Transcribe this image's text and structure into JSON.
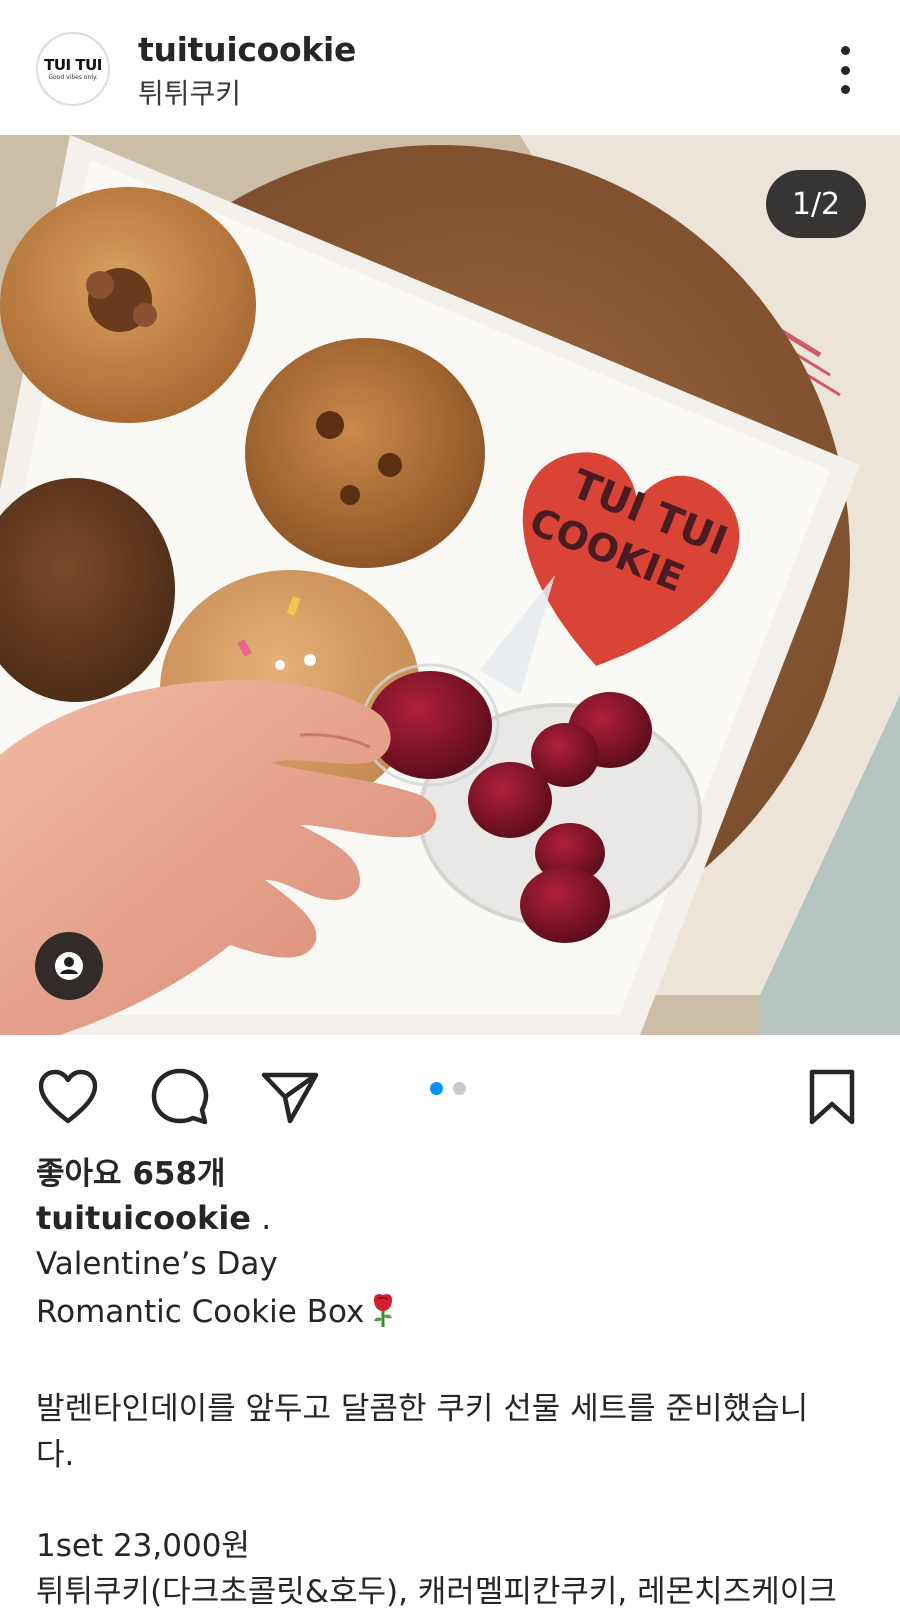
{
  "header": {
    "avatar_logo_text": "TUI TUI",
    "avatar_logo_sub": "Good vibes only.",
    "username": "tuituicookie",
    "display_name": "튀튀쿠키",
    "more_icon": "more-vertical-icon"
  },
  "post": {
    "media_counter": "1/2",
    "media_count": 2,
    "current_index": 1,
    "heart_cookie_text": "TUI TUI COOKIE",
    "tag_icon": "person-tag-icon"
  },
  "actions": {
    "like_icon": "heart-icon",
    "comment_icon": "comment-icon",
    "share_icon": "paper-plane-icon",
    "save_icon": "bookmark-icon"
  },
  "caption": {
    "likes": "좋아요 658개",
    "username": "tuituicookie",
    "username_suffix": " .",
    "line1": "Valentine’s Day",
    "line2": "Romantic Cookie Box",
    "line2_emoji": "rose-emoji",
    "line3": "발렌타인데이를 앞두고 달콤한 쿠키 선물 세트를 준비했습니",
    "line4": "다.",
    "line5": "1set 23,000원",
    "line6": "튀튀쿠키(다크초콜릿&호두), 캐러멜피칸쿠키, 레몬치즈케이크"
  },
  "colors": {
    "accent_dot": "#0095f6",
    "text": "#262626",
    "heart_cookie": "#d94436"
  }
}
